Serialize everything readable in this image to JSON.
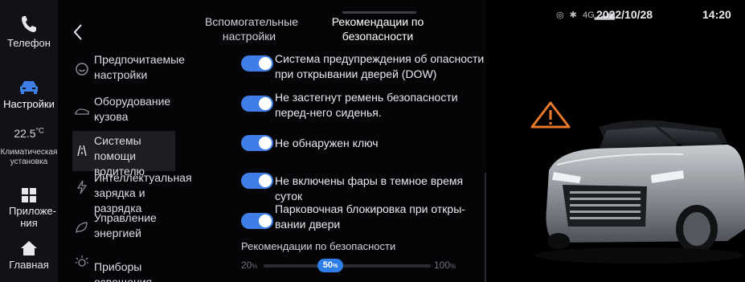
{
  "rail": {
    "phone_label": "Телефон",
    "settings_label": "Настройки",
    "climate_temp": "22.5",
    "climate_unit": "°C",
    "climate_label": "Климатическая установка",
    "apps_label": "Приложе-ния",
    "home_label": "Главная"
  },
  "tabs": [
    {
      "label": "Вспомогательные настройки"
    },
    {
      "label": "Рекомендации по безопасности"
    }
  ],
  "menu": [
    {
      "label": "Предпочитаемые настройки",
      "icon": "smiley-icon"
    },
    {
      "label": "Оборудование кузова",
      "icon": "car-body-icon"
    },
    {
      "label": "Системы помощи водителю",
      "icon": "lane-assist-icon"
    },
    {
      "label": "Интеллектуальная зарядка и разрядка",
      "icon": "charging-icon"
    },
    {
      "label": "Управление энергией",
      "icon": "leaf-icon"
    },
    {
      "label": "Приборы освещения",
      "icon": "light-icon"
    }
  ],
  "options": [
    {
      "label": "Система предупреждения об опасности при открывании дверей (DOW)",
      "enabled": true
    },
    {
      "label": "Не застегнут ремень безопасности перед-него сиденья.",
      "enabled": true
    },
    {
      "label": "Не обнаружен ключ",
      "enabled": true
    },
    {
      "label": "Не включены фары в темное время суток",
      "enabled": true
    },
    {
      "label": "Парковочная блокировка при откры-вании двери",
      "enabled": true
    }
  ],
  "slider": {
    "title": "Рекомендации по безопасности",
    "min": "20",
    "max": "100",
    "value": "50",
    "unit": "%",
    "fraction": 0.375
  },
  "status": {
    "signal": "4G",
    "date": "2022/10/28",
    "time": "14:20"
  },
  "colors": {
    "accent": "#3e7ee6",
    "warning": "#e8792b"
  }
}
